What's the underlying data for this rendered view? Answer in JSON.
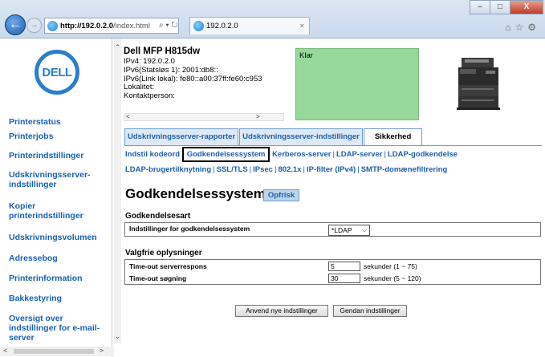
{
  "browser": {
    "url_host": "http://192.0.2.0",
    "url_path": "/index.html",
    "search_controls": "⌕ ▾ ↻",
    "tab_title": "192.0.2.0",
    "tab_close": "×",
    "window_min": "–",
    "window_max": "□",
    "window_close": "X",
    "toolbar_icons": "⌂☆⚙"
  },
  "logo_text": "DELL",
  "nav": {
    "items": [
      {
        "label": "Printerstatus"
      },
      {
        "label": "Printerjobs"
      },
      {
        "label": "Printerindstillinger"
      },
      {
        "label": "Udskrivningsserver-indstillinger"
      },
      {
        "label": "Kopier printerindstillinger"
      },
      {
        "label": "Udskrivningsvolumen"
      },
      {
        "label": "Adressebog"
      },
      {
        "label": "Printerinformation"
      },
      {
        "label": "Bakkestyring"
      },
      {
        "label": "Oversigt over indstillinger for e-mail-server"
      }
    ]
  },
  "device": {
    "name": "Dell MFP H815dw",
    "lines": [
      "IPv4: 192.0.2.0",
      "IPv6(Statsløs 1): 2001:db8::",
      "IPv6(Link lokal): fe80::a00:37ff:fe60:c953",
      "Lokalitet:",
      "Kontaktperson:"
    ],
    "status": "Klar",
    "status_color": "#96d99a"
  },
  "tabs": [
    {
      "label": "Udskrivningsserver-rapporter",
      "active": false
    },
    {
      "label": "Udskrivningsserver-indstillinger",
      "active": false
    },
    {
      "label": "Sikkerhed",
      "active": true
    }
  ],
  "sublinks_row1": [
    "Indstil kodeord",
    "Godkendelsessystem",
    "Kerberos-server",
    "LDAP-server",
    "LDAP-godkendelse"
  ],
  "sublinks_row2": [
    "LDAP-brugertilknytning",
    "SSL/TLS",
    "IPsec",
    "802.1x",
    "IP-filter (IPv4)",
    "SMTP-domænefiltrering"
  ],
  "page": {
    "title": "Godkendelsessystem -",
    "refresh_label": "Opfrisk"
  },
  "auth": {
    "heading": "Godkendelsesart",
    "row_label": "Indstillinger for godkendelsessystem",
    "selected": "*LDAP"
  },
  "optional": {
    "heading": "Valgfrie oplysninger",
    "rows": [
      {
        "label": "Time-out serverrespons",
        "value": "5",
        "hint": "sekunder (1 ~ 75)"
      },
      {
        "label": "Time-out søgning",
        "value": "30",
        "hint": "sekunder (5 ~ 120)"
      }
    ]
  },
  "buttons": {
    "apply": "Anvend nye indstillinger",
    "restore": "Gendan indstillinger"
  }
}
